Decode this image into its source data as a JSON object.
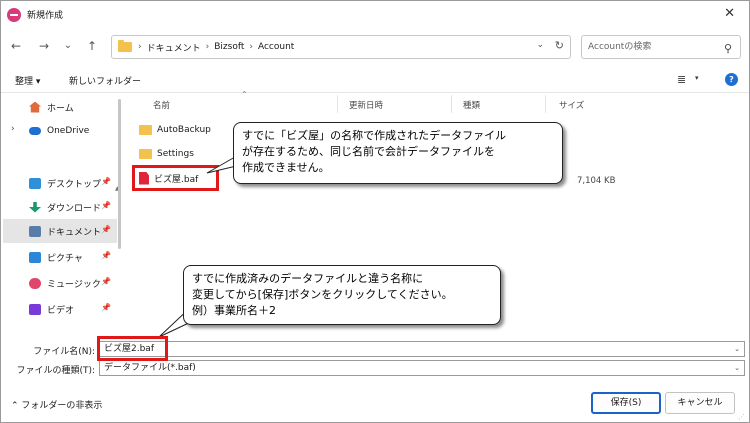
{
  "window": {
    "title": "新規作成",
    "close_glyph": "✕"
  },
  "nav": {
    "back": "←",
    "forward": "→",
    "recent": "⌄",
    "up": "↑"
  },
  "address": {
    "crumbs": [
      "ドキュメント",
      "Bizsoft",
      "Account"
    ],
    "separator": "›",
    "chevron": "⌄",
    "refresh": "↻"
  },
  "search": {
    "placeholder": "Accountの検索",
    "icon": "⚲"
  },
  "toolbar": {
    "organize": "整理 ▾",
    "new_folder": "新しいフォルダー",
    "view_glyph": "≣",
    "view_chevron": "▾",
    "help": "?"
  },
  "sidebar": {
    "items": [
      {
        "label": "ホーム"
      },
      {
        "label": "OneDrive"
      },
      {
        "label": "デスクトップ"
      },
      {
        "label": "ダウンロード"
      },
      {
        "label": "ドキュメント"
      },
      {
        "label": "ピクチャ"
      },
      {
        "label": "ミュージック"
      },
      {
        "label": "ビデオ"
      }
    ],
    "expand_glyph": "›",
    "pin_glyph": "📌",
    "scroll_up": "▲"
  },
  "columns": {
    "name": "名前",
    "modified": "更新日時",
    "type": "種類",
    "size": "サイズ",
    "sort_caret": "⌃"
  },
  "files": [
    {
      "name": "AutoBackup",
      "kind": "folder"
    },
    {
      "name": "Settings",
      "kind": "folder"
    },
    {
      "name": "ビズ屋.baf",
      "kind": "baf",
      "size": "7,104 KB"
    }
  ],
  "callouts": {
    "top": [
      "すでに「ビズ屋」の名称で作成されたデータファイル",
      "が存在するため、同じ名前で会計データファイルを",
      "作成できません。"
    ],
    "bottom": [
      "すでに作成済みのデータファイルと違う名称に",
      "変更してから[保存]ボタンをクリックしてください。",
      "例）事業所名＋2"
    ]
  },
  "form": {
    "filename_label": "ファイル名(N):",
    "filename_value": "ビズ屋2.baf",
    "filetype_label": "ファイルの種類(T):",
    "filetype_value": "データファイル(*.baf)",
    "dropdown_glyph": "⌄"
  },
  "footer": {
    "hide_folders": "フォルダーの非表示",
    "save": "保存(S)",
    "cancel": "キャンセル",
    "grip": "⋰"
  },
  "colors": {
    "accent": "#1a64c8",
    "highlight_red": "#e01818",
    "folder": "#f2c14e",
    "baf_file": "#e0223a",
    "selection": "#e5e5e5"
  },
  "icons": [
    "app-icon",
    "back-arrow-icon",
    "forward-arrow-icon",
    "recent-chevron-icon",
    "up-arrow-icon",
    "folder-icon",
    "refresh-icon",
    "search-icon",
    "view-icon",
    "help-icon",
    "home-icon",
    "onedrive-icon",
    "desktop-icon",
    "download-icon",
    "document-icon",
    "pictures-icon",
    "music-icon",
    "video-icon",
    "pin-icon",
    "baf-file-icon",
    "chevron-up-icon",
    "dropdown-chevron-icon",
    "resize-grip-icon"
  ]
}
